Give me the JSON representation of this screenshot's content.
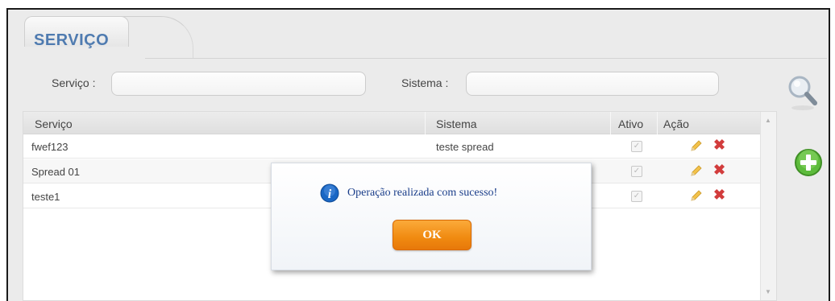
{
  "tab": {
    "title": "SERVIÇO"
  },
  "filters": {
    "servico_label": "Serviço :",
    "servico_value": "",
    "sistema_label": "Sistema :",
    "sistema_value": ""
  },
  "grid": {
    "columns": [
      "Serviço",
      "Sistema",
      "Ativo",
      "Ação"
    ],
    "rows": [
      {
        "servico": "fwef123",
        "sistema": "teste spread",
        "ativo": true
      },
      {
        "servico": "Spread 01",
        "sistema": "",
        "ativo": true
      },
      {
        "servico": "teste1",
        "sistema": "",
        "ativo": true
      }
    ]
  },
  "dialog": {
    "message": "Operação realizada com sucesso!",
    "ok_label": "OK"
  },
  "icons": {
    "search": "search-icon",
    "add": "add-icon",
    "edit": "pencil-icon",
    "delete": "delete-icon",
    "info": "info-icon"
  },
  "colors": {
    "title": "#4f7bb0",
    "ok_button": "#f08a10",
    "delete": "#d23c3c",
    "add": "#4caf32",
    "info": "#1a67c4"
  }
}
